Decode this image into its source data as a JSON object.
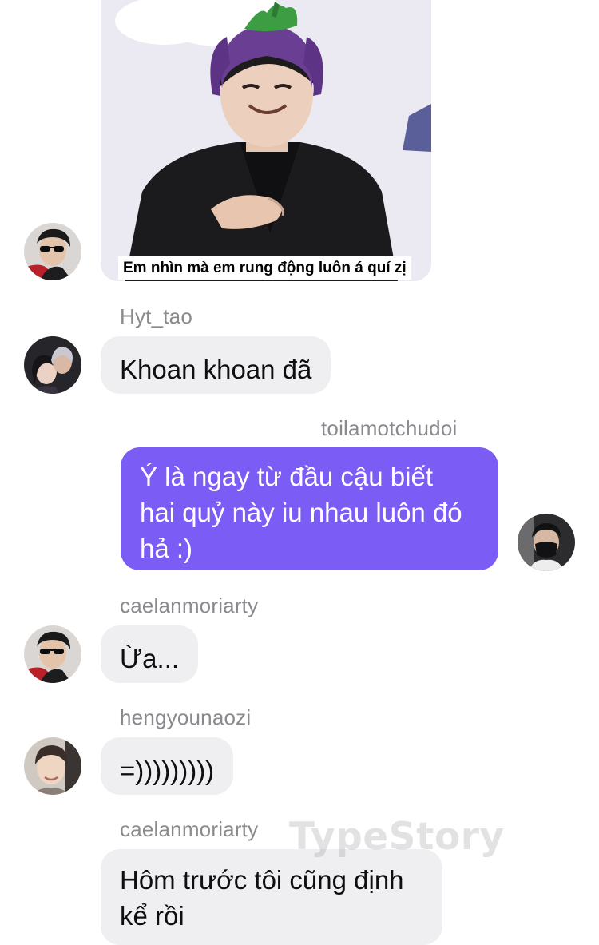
{
  "image_message": {
    "caption": "Em nhìn mà em rung động luôn á quí zị",
    "sender_avatar": "avatar-sunglasses"
  },
  "messages": [
    {
      "username": "Hyt_tao",
      "text": "Khoan khoan đã",
      "avatar": "avatar-couple"
    },
    {
      "username": "toilamotchudoi",
      "lines": [
        "Ý là ngay từ đầu cậu biết",
        "hai quỷ này iu nhau luôn đó",
        "hả :)"
      ],
      "avatar": "avatar-mask"
    },
    {
      "username": "caelanmoriarty",
      "text": "Ừa...",
      "avatar": "avatar-sunglasses"
    },
    {
      "username": "hengyounaozi",
      "text": "=)))))))))",
      "avatar": "avatar-young-man"
    },
    {
      "username": "caelanmoriarty",
      "lines": [
        "Hôm trước tôi cũng định",
        "kể rồi"
      ]
    }
  ],
  "watermark": "TypeStory",
  "colors": {
    "my_bubble": "#7b5cf5",
    "other_bubble": "#efeff2",
    "username_text": "#8a8a8e"
  }
}
